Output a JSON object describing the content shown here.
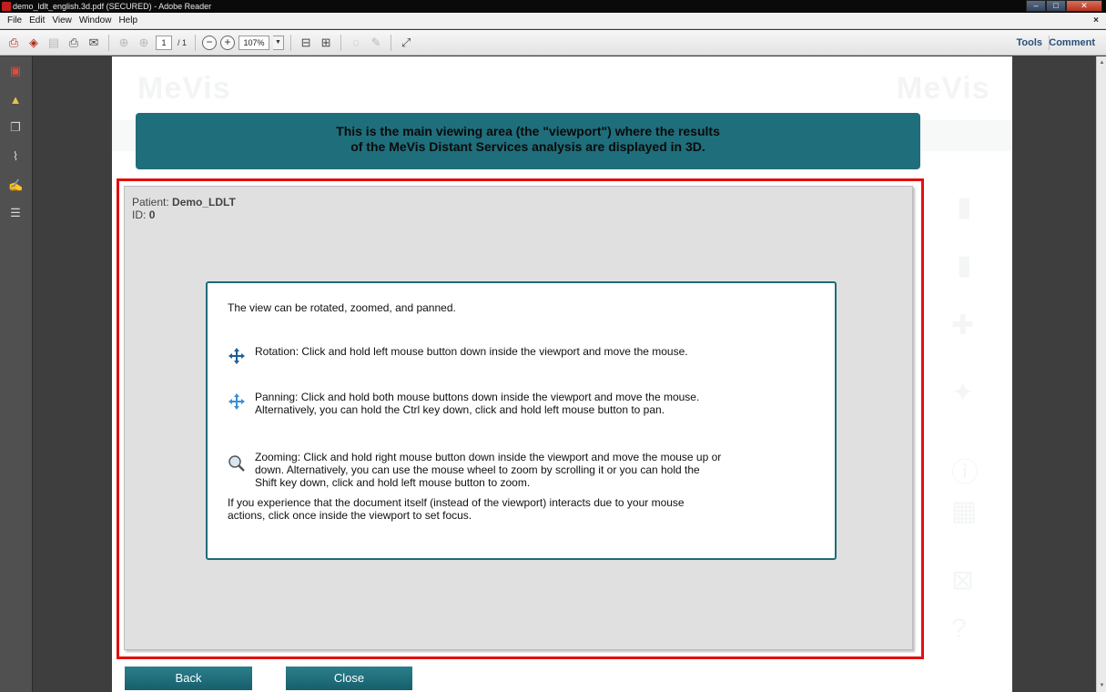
{
  "window": {
    "title": "demo_ldlt_english.3d.pdf (SECURED) - Adobe Reader"
  },
  "menu": {
    "items": [
      "File",
      "Edit",
      "View",
      "Window",
      "Help"
    ]
  },
  "toolbar": {
    "page_current": "1",
    "page_total": "/ 1",
    "zoom": "107%",
    "tools_label": "Tools",
    "comment_label": "Comment"
  },
  "page": {
    "logo_text": "MeVis",
    "banner_line1": "This is the main viewing area (the \"viewport\") where the results",
    "banner_line2": "of the MeVis Distant Services analysis are displayed in 3D.",
    "patient_label": "Patient:",
    "patient_name": "Demo_LDLT",
    "id_label": "ID:",
    "id_value": "0",
    "info": {
      "intro": "The view can be rotated, zoomed, and panned.",
      "rotation": "Rotation: Click and hold left mouse button down inside the viewport and move the mouse.",
      "panning_1": "Panning: Click and hold both mouse buttons down inside the viewport and move the mouse.",
      "panning_2": "Alternatively, you can hold the Ctrl key down, click and hold left mouse button to pan.",
      "zooming_1": "Zooming: Click and hold right mouse button down inside the viewport and move the mouse up or",
      "zooming_2": "down. Alternatively, you can use the mouse wheel to zoom by scrolling it or you can hold the",
      "zooming_3": "Shift key down, click and hold left mouse button to zoom.",
      "focus_1": "If you experience that the document itself (instead of the viewport) interacts due to your mouse",
      "focus_2": "actions, click once inside the viewport to set focus."
    },
    "back_label": "Back",
    "close_label": "Close"
  },
  "colors": {
    "banner": "#1f6e7b",
    "highlight_frame": "#e30f0f",
    "button": "#1f6e7b"
  }
}
